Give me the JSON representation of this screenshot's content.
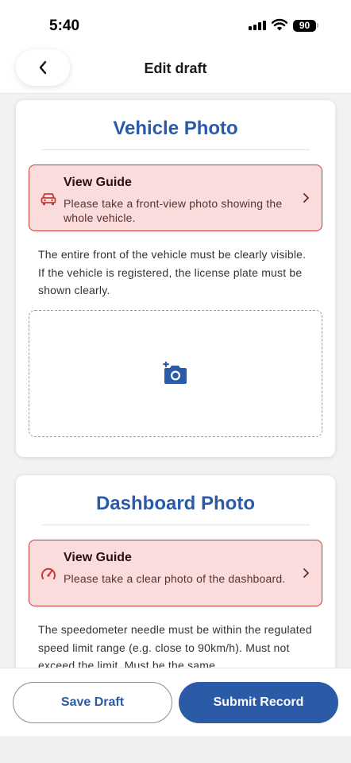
{
  "status_bar": {
    "time": "5:40",
    "battery": "90"
  },
  "header": {
    "title": "Edit draft",
    "back_icon": "chevron-left-icon"
  },
  "sections": [
    {
      "title": "Vehicle Photo",
      "guide": {
        "title": "View Guide",
        "description": "Please take a front-view photo showing the whole vehicle.",
        "icon": "car-icon"
      },
      "description": "The entire front of the vehicle must be clearly visible. If the vehicle is registered, the license plate must be shown clearly.",
      "upload_icon": "add-photo-icon"
    },
    {
      "title": "Dashboard Photo",
      "guide": {
        "title": "View Guide",
        "description": "Please take a clear photo of the dashboard.",
        "icon": "speedometer-icon"
      },
      "description": "The speedometer needle must be within the regulated speed limit range (e.g. close to 90km/h). Must not exceed the limit. Must be the same"
    }
  ],
  "actions": {
    "save_draft": "Save Draft",
    "submit": "Submit Record"
  },
  "colors": {
    "accent": "#2b5ba6",
    "guide_bg": "#fbdcdc",
    "guide_border": "#c43b3b"
  }
}
